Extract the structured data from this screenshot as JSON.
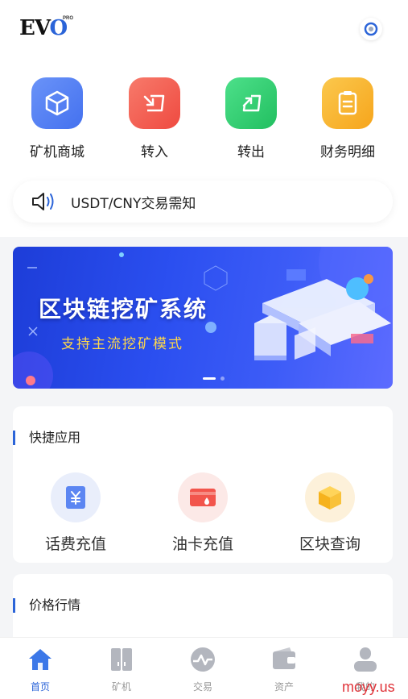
{
  "header": {
    "logo_text": "EVO",
    "logo_badge": "PRO"
  },
  "quick_actions": [
    {
      "label": "矿机商城",
      "icon": "cube-icon",
      "color": "#4f7cf5"
    },
    {
      "label": "转入",
      "icon": "transfer-in-icon",
      "color": "#f2554c"
    },
    {
      "label": "转出",
      "icon": "transfer-out-icon",
      "color": "#2fc76b"
    },
    {
      "label": "财务明细",
      "icon": "document-icon",
      "color": "#f9b52a"
    }
  ],
  "notice": {
    "text": "USDT/CNY交易需知"
  },
  "banner": {
    "title": "区块链挖矿系统",
    "subtitle": "支持主流挖矿模式"
  },
  "apps_section": {
    "title": "快捷应用",
    "items": [
      {
        "label": "话费充值",
        "icon": "yen-card-icon"
      },
      {
        "label": "油卡充值",
        "icon": "fuel-card-icon"
      },
      {
        "label": "区块查询",
        "icon": "block-cube-icon"
      }
    ]
  },
  "price_section": {
    "title": "价格行情"
  },
  "tabbar": [
    {
      "label": "首页",
      "icon": "home-icon",
      "active": true
    },
    {
      "label": "矿机",
      "icon": "miner-icon",
      "active": false
    },
    {
      "label": "交易",
      "icon": "trade-icon",
      "active": false
    },
    {
      "label": "资产",
      "icon": "wallet-icon",
      "active": false
    },
    {
      "label": "我的",
      "icon": "user-icon",
      "active": false
    }
  ],
  "watermark": "moyy.us",
  "colors": {
    "accent": "#2b64d8",
    "banner_bg": "#2b4ff0",
    "banner_subtitle": "#ffd84a"
  }
}
